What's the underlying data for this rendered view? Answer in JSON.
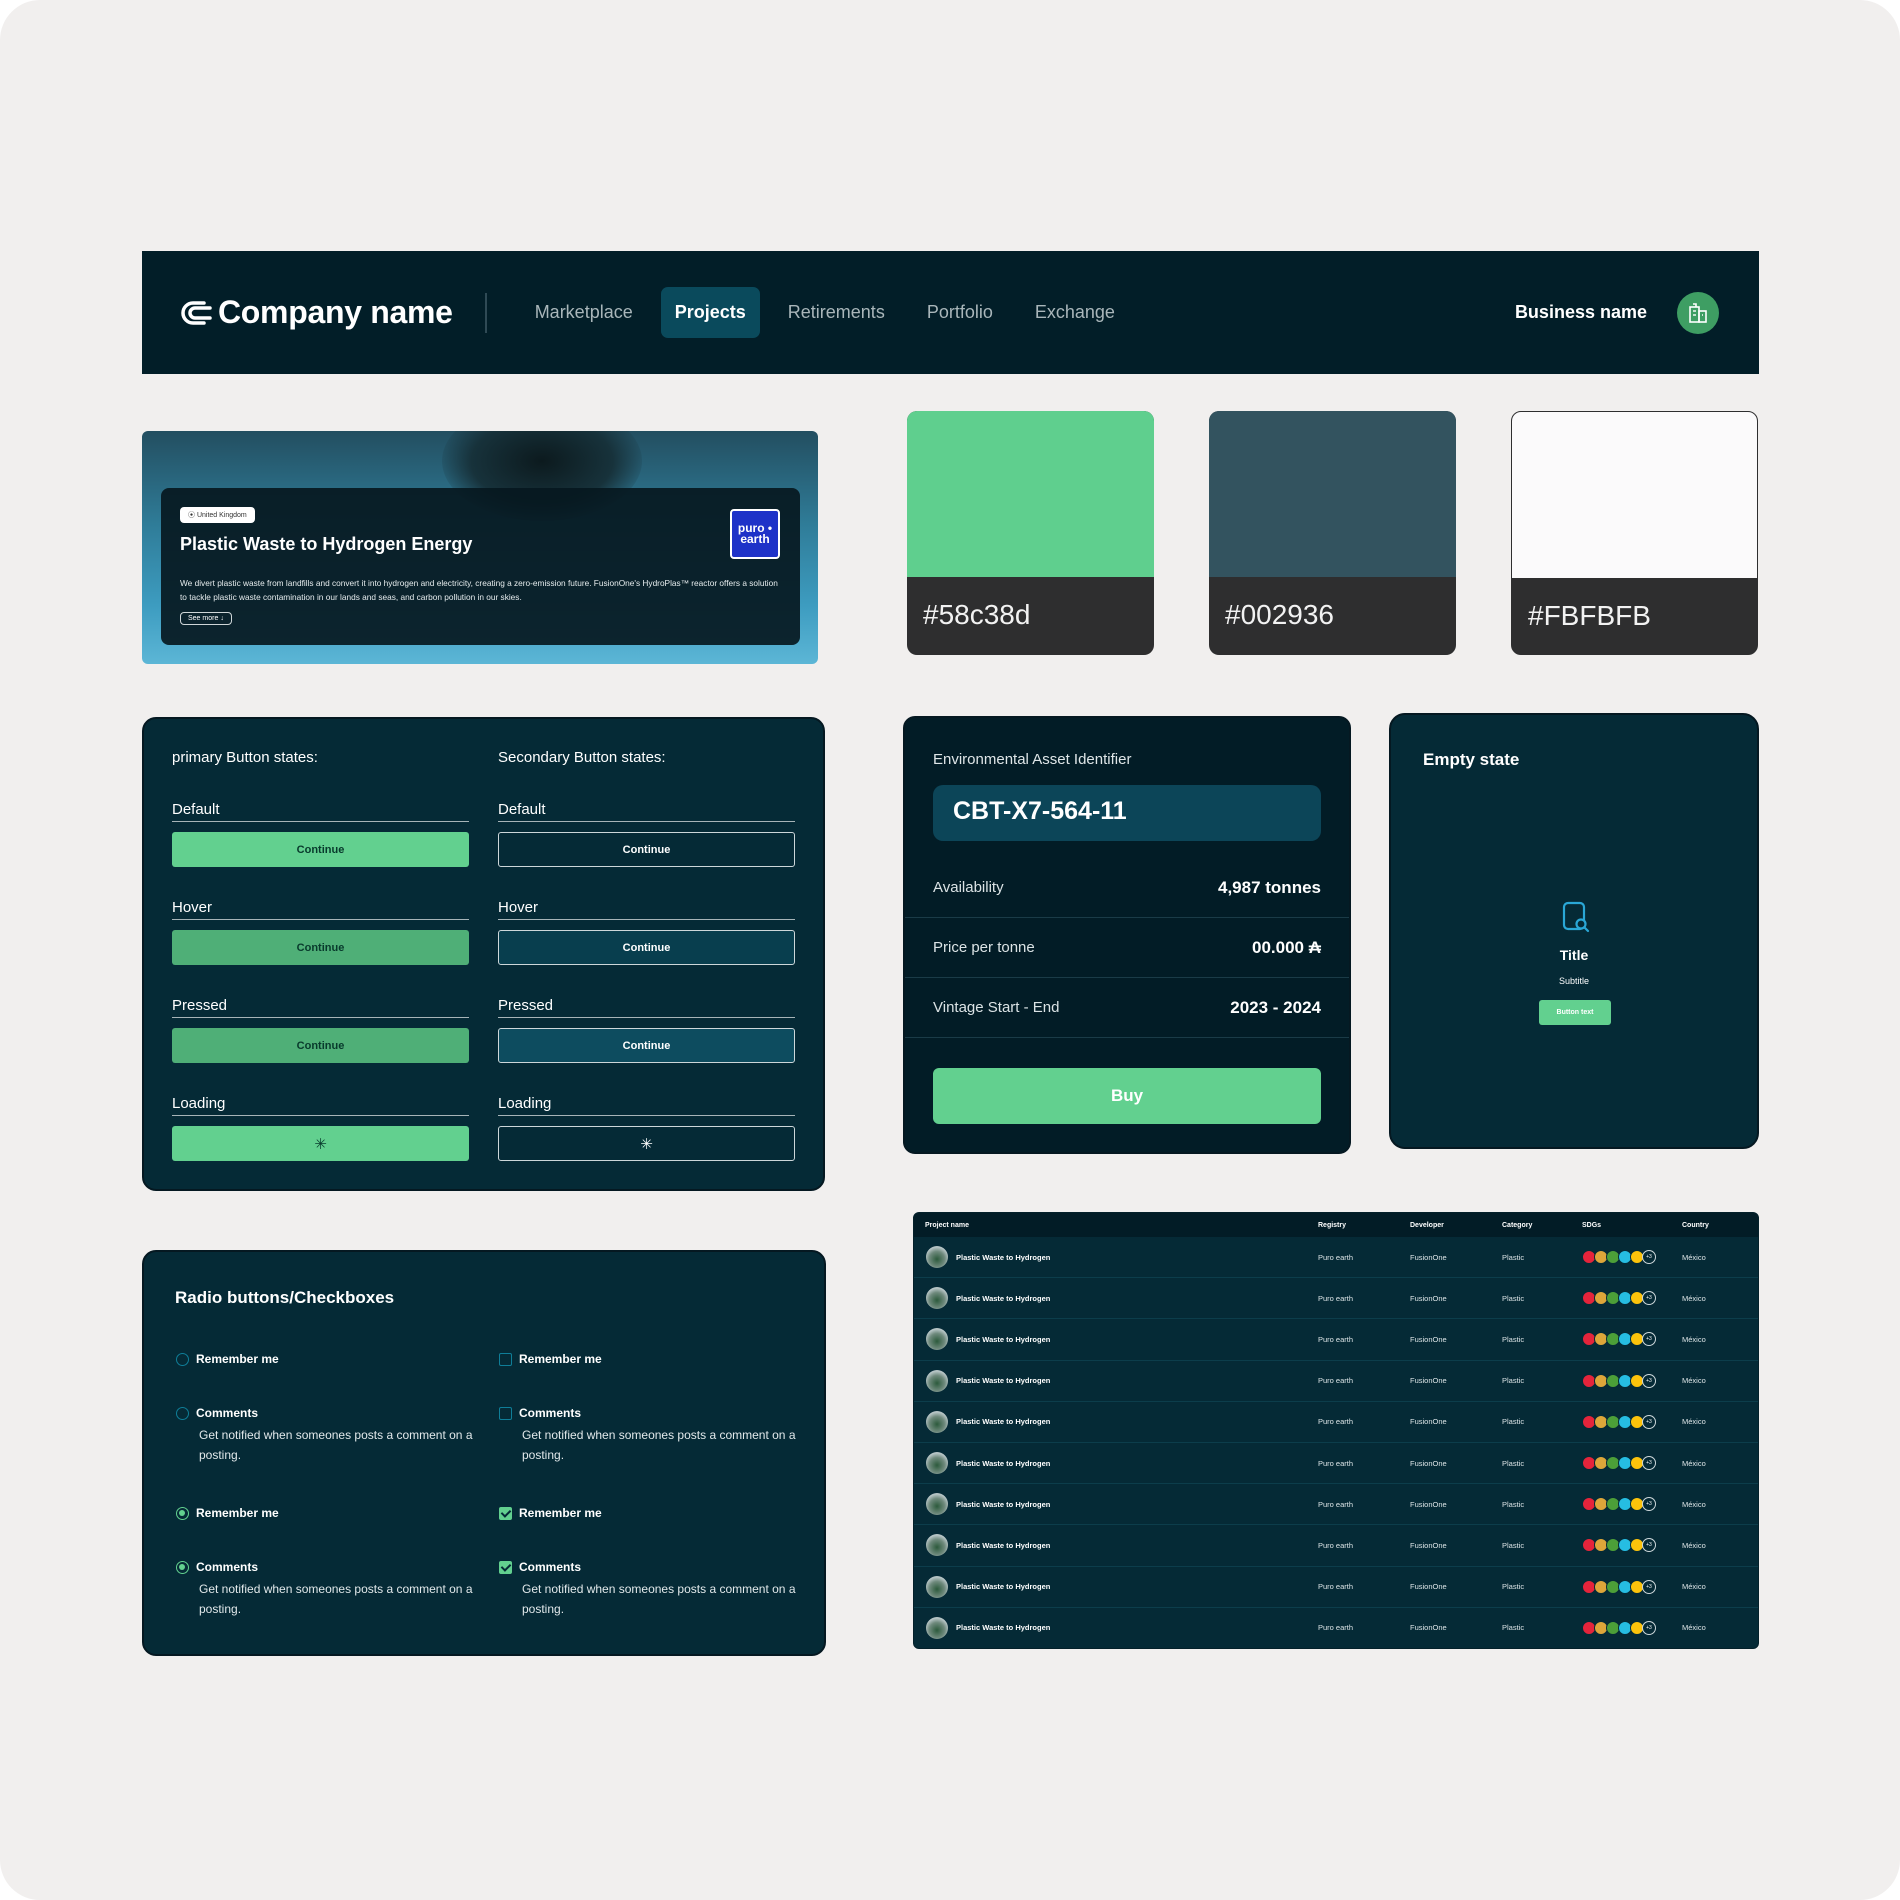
{
  "header": {
    "brand": "Company name",
    "nav": [
      {
        "label": "Marketplace",
        "active": false
      },
      {
        "label": "Projects",
        "active": true
      },
      {
        "label": "Retirements",
        "active": false
      },
      {
        "label": "Portfolio",
        "active": false
      },
      {
        "label": "Exchange",
        "active": false
      }
    ],
    "business_name": "Business name",
    "business_icon": "building-icon"
  },
  "hero": {
    "location": "United Kingdom",
    "title": "Plastic Waste to Hydrogen Energy",
    "description": "We divert plastic waste from landfills and convert it into hydrogen and electricity, creating a zero-emission future. FusionOne's HydroPlas™ reactor offers a solution to tackle plastic waste contamination in our lands and seas, and carbon pollution in our skies.",
    "see_more": "See more",
    "badge": "puro • earth"
  },
  "swatches": [
    {
      "label": "#58c38d",
      "color": "#5fcf8e"
    },
    {
      "label": "#002936",
      "color": "#33535f"
    },
    {
      "label": "#FBFBFB",
      "color": "#fbfafb"
    }
  ],
  "buttons": {
    "primary_heading": "primary Button states:",
    "secondary_heading": "Secondary Button states:",
    "states": [
      "Default",
      "Hover",
      "Pressed",
      "Loading"
    ],
    "button_label": "Continue"
  },
  "asset": {
    "label": "Environmental Asset Identifier",
    "identifier": "CBT-X7-564-11",
    "rows": [
      {
        "key": "Availability",
        "value": "4,987 tonnes"
      },
      {
        "key": "Price per tonne",
        "value": "00.000 ₳"
      },
      {
        "key": "Vintage Start - End",
        "value": "2023 - 2024"
      }
    ],
    "buy_label": "Buy"
  },
  "empty_state": {
    "heading": "Empty state",
    "title": "Title",
    "subtitle": "Subtitle",
    "button": "Button text"
  },
  "radios": {
    "heading": "Radio buttons/Checkboxes",
    "remember": "Remember me",
    "comments": "Comments",
    "comments_desc": "Get notified when someones posts a comment on a posting."
  },
  "table": {
    "columns": [
      "Project name",
      "Registry",
      "Developer",
      "Category",
      "SDGs",
      "Country"
    ],
    "sdg_colors": [
      "#e5243b",
      "#dda63a",
      "#4c9f38",
      "#26bde2",
      "#fcc30b"
    ],
    "sdg_more": "+3",
    "rows": [
      {
        "name": "Plastic Waste to Hydrogen",
        "registry": "Puro earth",
        "developer": "FusionOne",
        "category": "Plastic",
        "country": "México"
      },
      {
        "name": "Plastic Waste to Hydrogen",
        "registry": "Puro earth",
        "developer": "FusionOne",
        "category": "Plastic",
        "country": "México"
      },
      {
        "name": "Plastic Waste to Hydrogen",
        "registry": "Puro earth",
        "developer": "FusionOne",
        "category": "Plastic",
        "country": "México"
      },
      {
        "name": "Plastic Waste to Hydrogen",
        "registry": "Puro earth",
        "developer": "FusionOne",
        "category": "Plastic",
        "country": "México"
      },
      {
        "name": "Plastic Waste to Hydrogen",
        "registry": "Puro earth",
        "developer": "FusionOne",
        "category": "Plastic",
        "country": "México"
      },
      {
        "name": "Plastic Waste to Hydrogen",
        "registry": "Puro earth",
        "developer": "FusionOne",
        "category": "Plastic",
        "country": "México"
      },
      {
        "name": "Plastic Waste to Hydrogen",
        "registry": "Puro earth",
        "developer": "FusionOne",
        "category": "Plastic",
        "country": "México"
      },
      {
        "name": "Plastic Waste to Hydrogen",
        "registry": "Puro earth",
        "developer": "FusionOne",
        "category": "Plastic",
        "country": "México"
      },
      {
        "name": "Plastic Waste to Hydrogen",
        "registry": "Puro earth",
        "developer": "FusionOne",
        "category": "Plastic",
        "country": "México"
      },
      {
        "name": "Plastic Waste to Hydrogen",
        "registry": "Puro earth",
        "developer": "FusionOne",
        "category": "Plastic",
        "country": "México"
      }
    ]
  }
}
